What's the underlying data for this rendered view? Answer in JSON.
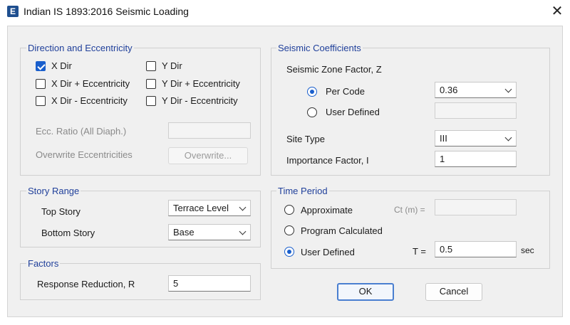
{
  "window": {
    "title": "Indian IS 1893:2016 Seismic Loading",
    "app_icon_letter": "E",
    "close_glyph": "✕"
  },
  "direction": {
    "title": "Direction and Eccentricity",
    "x_dir": {
      "label": "X Dir",
      "checked": true
    },
    "x_dir_plus": {
      "label": "X Dir + Eccentricity",
      "checked": false
    },
    "x_dir_minus": {
      "label": "X Dir - Eccentricity",
      "checked": false
    },
    "y_dir": {
      "label": "Y Dir",
      "checked": false
    },
    "y_dir_plus": {
      "label": "Y Dir + Eccentricity",
      "checked": false
    },
    "y_dir_minus": {
      "label": "Y Dir - Eccentricity",
      "checked": false
    },
    "ecc_ratio_label": "Ecc. Ratio (All Diaph.)",
    "ecc_ratio_value": "",
    "overwrite_label": "Overwrite Eccentricities",
    "overwrite_button": "Overwrite..."
  },
  "story": {
    "title": "Story Range",
    "top_label": "Top Story",
    "top_value": "Terrace Level",
    "bottom_label": "Bottom Story",
    "bottom_value": "Base"
  },
  "factors": {
    "title": "Factors",
    "rr_label": "Response Reduction, R",
    "rr_value": "5"
  },
  "coefficients": {
    "title": "Seismic Coefficients",
    "zone_label": "Seismic Zone Factor, Z",
    "per_code_label": "Per Code",
    "per_code_value": "0.36",
    "user_defined_label": "User Defined",
    "user_defined_value": "",
    "site_type_label": "Site Type",
    "site_type_value": "III",
    "importance_label": "Importance Factor, I",
    "importance_value": "1"
  },
  "time_period": {
    "title": "Time Period",
    "approximate_label": "Approximate",
    "ct_label": "Ct (m) =",
    "ct_value": "",
    "program_label": "Program Calculated",
    "user_label": "User Defined",
    "t_label": "T =",
    "t_value": "0.5",
    "t_unit": "sec"
  },
  "buttons": {
    "ok": "OK",
    "cancel": "Cancel"
  },
  "colors": {
    "accent": "#1a5fcc",
    "group_title": "#1f3f9a"
  }
}
